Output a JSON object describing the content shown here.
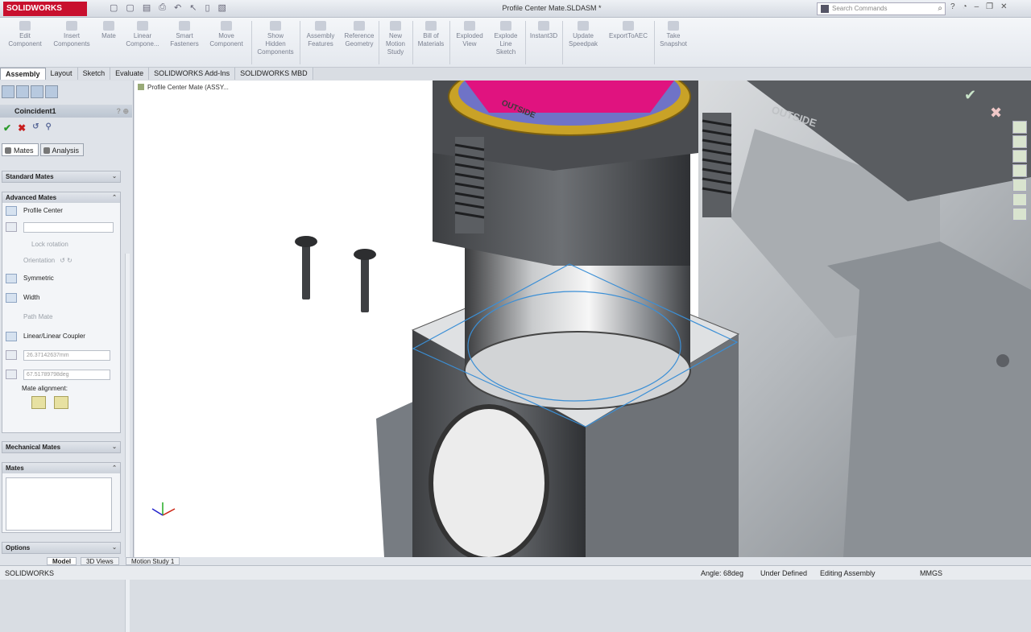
{
  "app": {
    "logo_text": "SOLIDWORKS",
    "doc_title": "Profile Center Mate.SLDASM *"
  },
  "search": {
    "placeholder": "Search Commands"
  },
  "quick_access": [
    "▢",
    "▢",
    "▤",
    "⎙",
    "↶",
    "↖",
    "▯",
    "▧"
  ],
  "commands": [
    {
      "label": "Edit\nComponent"
    },
    {
      "label": "Insert\nComponents"
    },
    {
      "label": "Mate"
    },
    {
      "label": "Linear\nCompone..."
    },
    {
      "label": "Smart\nFasteners"
    },
    {
      "label": "Move\nComponent"
    },
    {
      "label": "Show\nHidden\nComponents"
    },
    {
      "label": "Assembly\nFeatures"
    },
    {
      "label": "Reference\nGeometry"
    },
    {
      "label": "New\nMotion\nStudy"
    },
    {
      "label": "Bill of\nMaterials"
    },
    {
      "label": "Exploded\nView"
    },
    {
      "label": "Explode\nLine\nSketch"
    },
    {
      "label": "Instant3D"
    },
    {
      "label": "Update\nSpeedpak"
    },
    {
      "label": "ExportToAEC"
    },
    {
      "label": "Take\nSnapshot"
    }
  ],
  "tabs": [
    "Assembly",
    "Layout",
    "Sketch",
    "Evaluate",
    "SOLIDWORKS Add-Ins",
    "SOLIDWORKS MBD"
  ],
  "property_manager": {
    "title": "Coincident1",
    "subtabs": [
      "Mates",
      "Analysis"
    ],
    "groups": {
      "standard": "Standard Mates",
      "advanced": "Advanced Mates",
      "mechanical": "Mechanical Mates",
      "mates": "Mates",
      "options": "Options"
    },
    "advanced_items": {
      "profile_center": "Profile Center",
      "lock_rotation": "Lock rotation",
      "orientation": "Orientation",
      "symmetric": "Symmetric",
      "width": "Width",
      "path_mate": "Path Mate",
      "linear_coupler": "Linear/Linear Coupler",
      "distance_value": "26.37142637mm",
      "angle_value": "67.51789798deg",
      "mate_alignment": "Mate alignment:"
    }
  },
  "viewport": {
    "tree_item": "Profile Center Mate (ASSY...",
    "engraving": "OUTSIDE"
  },
  "bottom_tabs": [
    "Model",
    "3D Views",
    "Motion Study 1"
  ],
  "status": {
    "app": "SOLIDWORKS",
    "angle": "Angle: 68deg",
    "defined": "Under Defined",
    "mode": "Editing Assembly",
    "units": "MMGS"
  }
}
